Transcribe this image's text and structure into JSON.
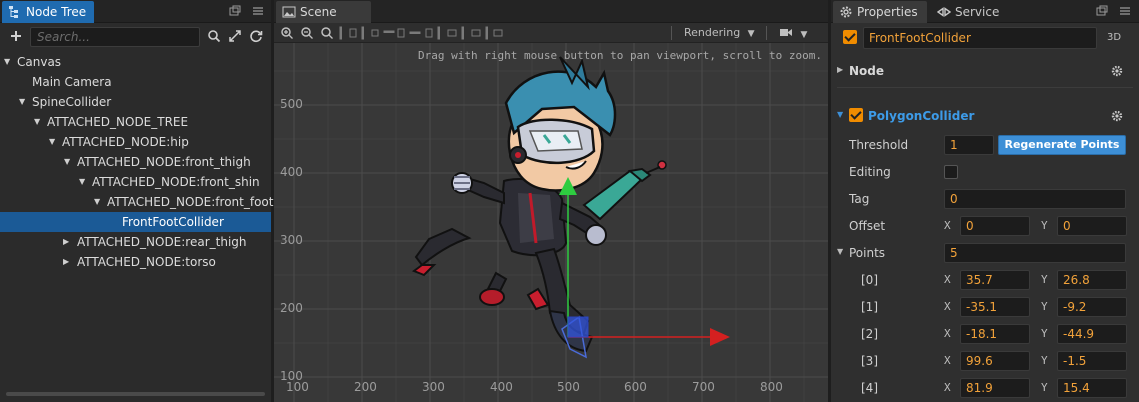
{
  "node_tree": {
    "tab_label": "Node Tree",
    "search": {
      "placeholder": "Search...",
      "value": ""
    },
    "items": [
      {
        "label": "Canvas",
        "expanded": true,
        "has_children": true
      },
      {
        "label": "Main Camera",
        "has_children": false
      },
      {
        "label": "SpineCollider",
        "expanded": true,
        "has_children": true
      },
      {
        "label": "ATTACHED_NODE_TREE",
        "expanded": true,
        "has_children": true
      },
      {
        "label": "ATTACHED_NODE:hip",
        "expanded": true,
        "has_children": true
      },
      {
        "label": "ATTACHED_NODE:front_thigh",
        "expanded": true,
        "has_children": true
      },
      {
        "label": "ATTACHED_NODE:front_shin",
        "expanded": true,
        "has_children": true
      },
      {
        "label": "ATTACHED_NODE:front_foot",
        "expanded": true,
        "has_children": true
      },
      {
        "label": "FrontFootCollider",
        "has_children": false,
        "selected": true
      },
      {
        "label": "ATTACHED_NODE:rear_thigh",
        "expanded": false,
        "has_children": true
      },
      {
        "label": "ATTACHED_NODE:torso",
        "expanded": false,
        "has_children": true
      }
    ]
  },
  "scene": {
    "tab_label": "Scene",
    "rendering_label": "Rendering",
    "hint": "Drag with right mouse button to pan viewport, scroll to zoom.",
    "x_axis_labels": [
      "100",
      "200",
      "300",
      "400",
      "500",
      "600",
      "700",
      "800"
    ],
    "y_axis_labels": [
      "500",
      "400",
      "300",
      "200",
      "100"
    ]
  },
  "properties": {
    "tab_label": "Properties",
    "service_tab_label": "Service",
    "node_name": "FrontFootCollider",
    "mode_label": "3D",
    "node_section_label": "Node",
    "component": {
      "name": "PolygonCollider",
      "enabled": true,
      "threshold_label": "Threshold",
      "threshold_value": "1",
      "regenerate_label": "Regenerate Points",
      "editing_label": "Editing",
      "editing_checked": false,
      "tag_label": "Tag",
      "tag_value": "0",
      "offset_label": "Offset",
      "offset": {
        "x": "0",
        "y": "0"
      },
      "points_label": "Points",
      "points_count": "5",
      "x_label": "X",
      "y_label": "Y",
      "points": [
        {
          "index": "[0]",
          "x": "35.7",
          "y": "26.8"
        },
        {
          "index": "[1]",
          "x": "-35.1",
          "y": "-9.2"
        },
        {
          "index": "[2]",
          "x": "-18.1",
          "y": "-44.9"
        },
        {
          "index": "[3]",
          "x": "99.6",
          "y": "-1.5"
        },
        {
          "index": "[4]",
          "x": "81.9",
          "y": "15.4"
        }
      ]
    }
  },
  "colors": {
    "accent_blue": "#1f6bb0",
    "value_orange": "#f2a23a",
    "checkbox_orange": "#f08c00",
    "gizmo_green": "#2ecc40",
    "gizmo_red": "#d42020"
  }
}
